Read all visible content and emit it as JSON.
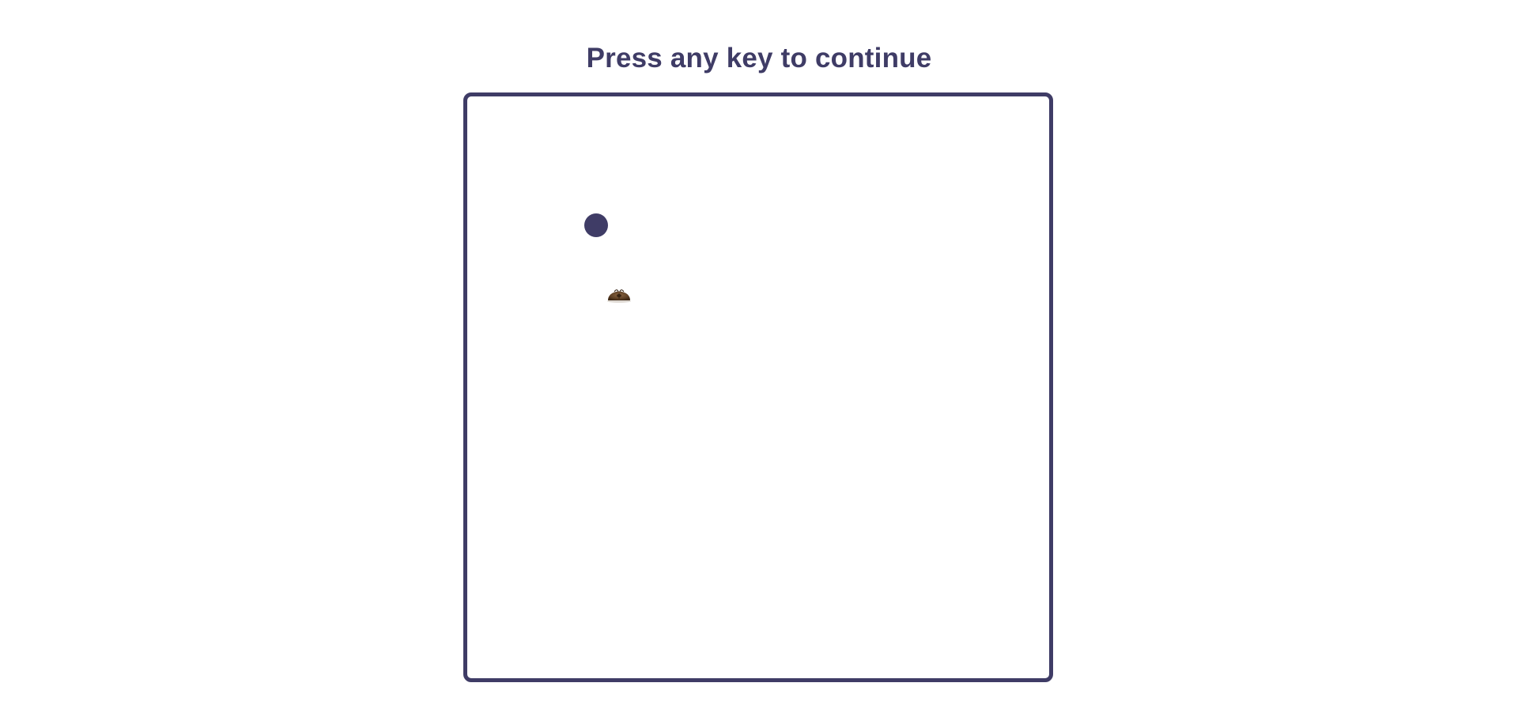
{
  "game": {
    "prompt_text": "Press any key to continue",
    "player": {
      "icon": "player-dot",
      "color": "#3f3c66"
    },
    "target": {
      "icon": "mole-icon",
      "color": "#6b4a2b"
    },
    "board": {
      "border_color": "#3f3c66",
      "background": "#ffffff"
    }
  }
}
